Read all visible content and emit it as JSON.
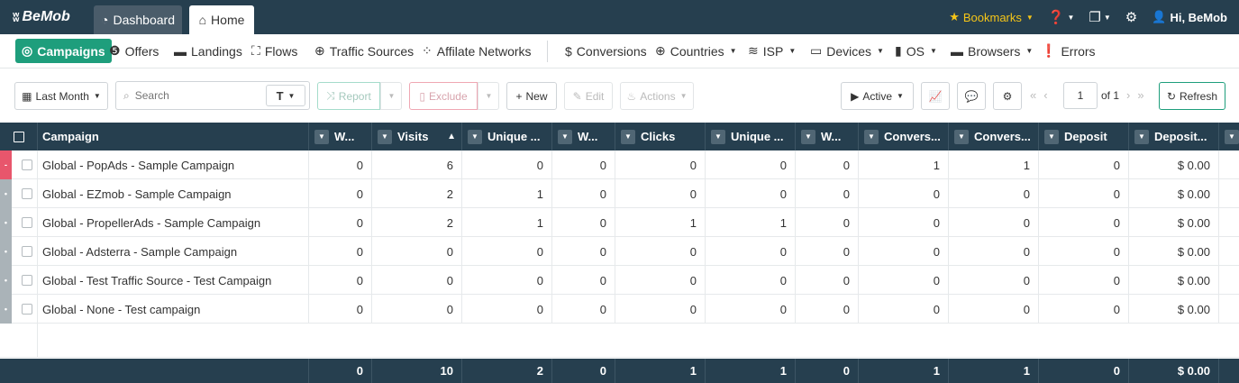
{
  "topbar": {
    "logo": "BeMob",
    "tabs": [
      {
        "label": "Dashboard"
      },
      {
        "label": "Home"
      }
    ],
    "bookmarks_label": "Bookmarks",
    "user_greeting": "Hi, BeMob"
  },
  "nav": {
    "items": [
      {
        "label": "Campaigns",
        "active": true
      },
      {
        "label": "Offers"
      },
      {
        "label": "Landings"
      },
      {
        "label": "Flows"
      },
      {
        "label": "Traffic Sources"
      },
      {
        "label": "Affilate Networks"
      },
      {
        "label": "Conversions"
      },
      {
        "label": "Countries"
      },
      {
        "label": "ISP"
      },
      {
        "label": "Devices"
      },
      {
        "label": "OS"
      },
      {
        "label": "Browsers"
      },
      {
        "label": "Errors"
      }
    ]
  },
  "toolbar": {
    "date_range": "Last Month",
    "search_placeholder": "Search",
    "search_type": "T",
    "report_label": "Report",
    "exclude_label": "Exclude",
    "new_label": "New",
    "edit_label": "Edit",
    "actions_label": "Actions",
    "status_filter": "Active",
    "page_number": "1",
    "page_of": "of 1",
    "refresh_label": "Refresh"
  },
  "table": {
    "columns": [
      "Campaign",
      "W...",
      "Visits",
      "Unique ...",
      "W...",
      "Clicks",
      "Unique ...",
      "W...",
      "Convers...",
      "Convers...",
      "Deposit",
      "Deposit..."
    ],
    "rows": [
      {
        "state": "-",
        "state_color": "#e8566c",
        "campaign": "Global - PopAds - Sample Campaign",
        "values": [
          "0",
          "6",
          "0",
          "0",
          "0",
          "0",
          "0",
          "1",
          "1",
          "0",
          "$ 0.00"
        ]
      },
      {
        "state": "•",
        "state_color": "#aab3b8",
        "campaign": "Global - EZmob - Sample Campaign",
        "values": [
          "0",
          "2",
          "1",
          "0",
          "0",
          "0",
          "0",
          "0",
          "0",
          "0",
          "$ 0.00"
        ]
      },
      {
        "state": "•",
        "state_color": "#aab3b8",
        "campaign": "Global - PropellerAds - Sample Campaign",
        "values": [
          "0",
          "2",
          "1",
          "0",
          "1",
          "1",
          "0",
          "0",
          "0",
          "0",
          "$ 0.00"
        ]
      },
      {
        "state": "•",
        "state_color": "#aab3b8",
        "campaign": "Global - Adsterra - Sample Campaign",
        "values": [
          "0",
          "0",
          "0",
          "0",
          "0",
          "0",
          "0",
          "0",
          "0",
          "0",
          "$ 0.00"
        ]
      },
      {
        "state": "•",
        "state_color": "#aab3b8",
        "campaign": "Global - Test Traffic Source - Test Campaign",
        "values": [
          "0",
          "0",
          "0",
          "0",
          "0",
          "0",
          "0",
          "0",
          "0",
          "0",
          "$ 0.00"
        ]
      },
      {
        "state": "•",
        "state_color": "#aab3b8",
        "campaign": "Global - None - Test campaign",
        "values": [
          "0",
          "0",
          "0",
          "0",
          "0",
          "0",
          "0",
          "0",
          "0",
          "0",
          "$ 0.00"
        ]
      }
    ],
    "totals": [
      "0",
      "10",
      "2",
      "0",
      "1",
      "1",
      "0",
      "1",
      "1",
      "0",
      "$ 0.00"
    ]
  },
  "colors": {
    "header_bg": "#263f4f",
    "accent": "#1e9e7c",
    "bookmark": "#f5c518"
  }
}
